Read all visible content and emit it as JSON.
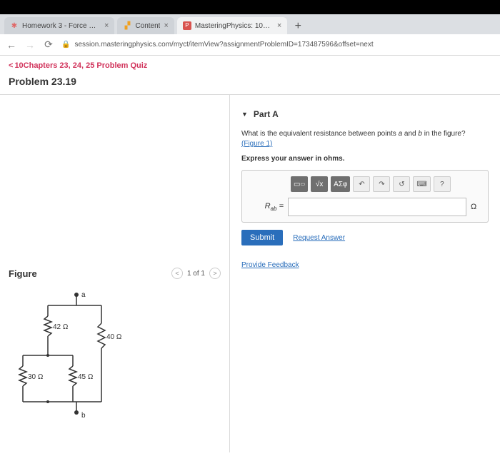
{
  "tabs": [
    {
      "title": "Homework 3 - Force Systems",
      "favicon_color": "#e06666"
    },
    {
      "title": "Content",
      "favicon_color": "#f0a020"
    },
    {
      "title": "MasteringPhysics: 10Chapters",
      "favicon_color": "#d9534f"
    }
  ],
  "url": "session.masteringphysics.com/myct/itemView?assignmentProblemID=173487596&offset=next",
  "breadcrumb": "10Chapters 23, 24, 25 Problem Quiz",
  "problem_title": "Problem 23.19",
  "part": {
    "label": "Part A",
    "question_pre": "What is the equivalent resistance between points ",
    "var_a": "a",
    "mid": " and ",
    "var_b": "b",
    "question_post": " in the figure? ",
    "figure_link": "(Figure 1)",
    "instruction": "Express your answer in ohms.",
    "var_label_html": "R",
    "var_sub": "ab",
    "equals": " =",
    "unit": "Ω",
    "toolbar": {
      "sqrt": "√x",
      "greek": "ΑΣφ",
      "undo": "↶",
      "redo": "↷",
      "reset": "↺",
      "keyboard": "⌨",
      "help": "?"
    },
    "submit": "Submit",
    "request": "Request Answer"
  },
  "feedback_link": "Provide Feedback",
  "figure": {
    "title": "Figure",
    "pager": "1 of 1",
    "node_a": "a",
    "node_b": "b",
    "r1": "42 Ω",
    "r2": "40 Ω",
    "r3": "30 Ω",
    "r4": "45 Ω"
  }
}
